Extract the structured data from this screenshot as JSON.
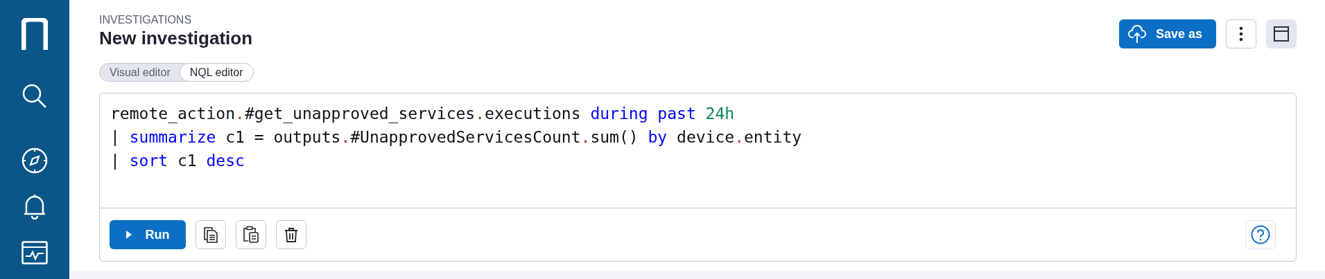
{
  "sidebar": {
    "items": [
      {
        "kind": "logo",
        "selected": false
      },
      {
        "kind": "search",
        "selected": false
      },
      {
        "kind": "compass",
        "selected": false
      },
      {
        "kind": "bell",
        "selected": false
      },
      {
        "kind": "dashboard",
        "selected": false
      }
    ]
  },
  "header": {
    "breadcrumb": "INVESTIGATIONS",
    "title": "New investigation",
    "save_button": "Save as"
  },
  "tabs": [
    {
      "label": "Visual editor",
      "selected": false
    },
    {
      "label": "NQL editor",
      "selected": true
    }
  ],
  "editor": {
    "lines": [
      [
        {
          "kind": "plain",
          "text": "remote_action",
          "separator": "."
        },
        {
          "kind": "plain",
          "text": "#get_unapproved_services",
          "separator": "."
        },
        {
          "kind": "plain",
          "text": "executions "
        },
        {
          "kind": "keyword",
          "text": "during past "
        },
        {
          "kind": "number",
          "text": "24h"
        }
      ],
      [
        {
          "kind": "pipe",
          "text": "| "
        },
        {
          "kind": "keyword",
          "text": "summarize"
        },
        {
          "kind": "plain",
          "text": " c1 = outputs",
          "separator": "."
        },
        {
          "kind": "plain",
          "text": "#UnapprovedServicesCount",
          "separator": "."
        },
        {
          "kind": "plain",
          "text": "sum() "
        },
        {
          "kind": "keyword",
          "text": "by"
        },
        {
          "kind": "plain",
          "text": " device",
          "separator": "."
        },
        {
          "kind": "plain",
          "text": "entity"
        }
      ],
      [
        {
          "kind": "pipe",
          "text": "| "
        },
        {
          "kind": "keyword",
          "text": "sort"
        },
        {
          "kind": "plain",
          "text": " c1 "
        },
        {
          "kind": "keyword",
          "text": "desc"
        }
      ]
    ],
    "run_button": "Run"
  }
}
